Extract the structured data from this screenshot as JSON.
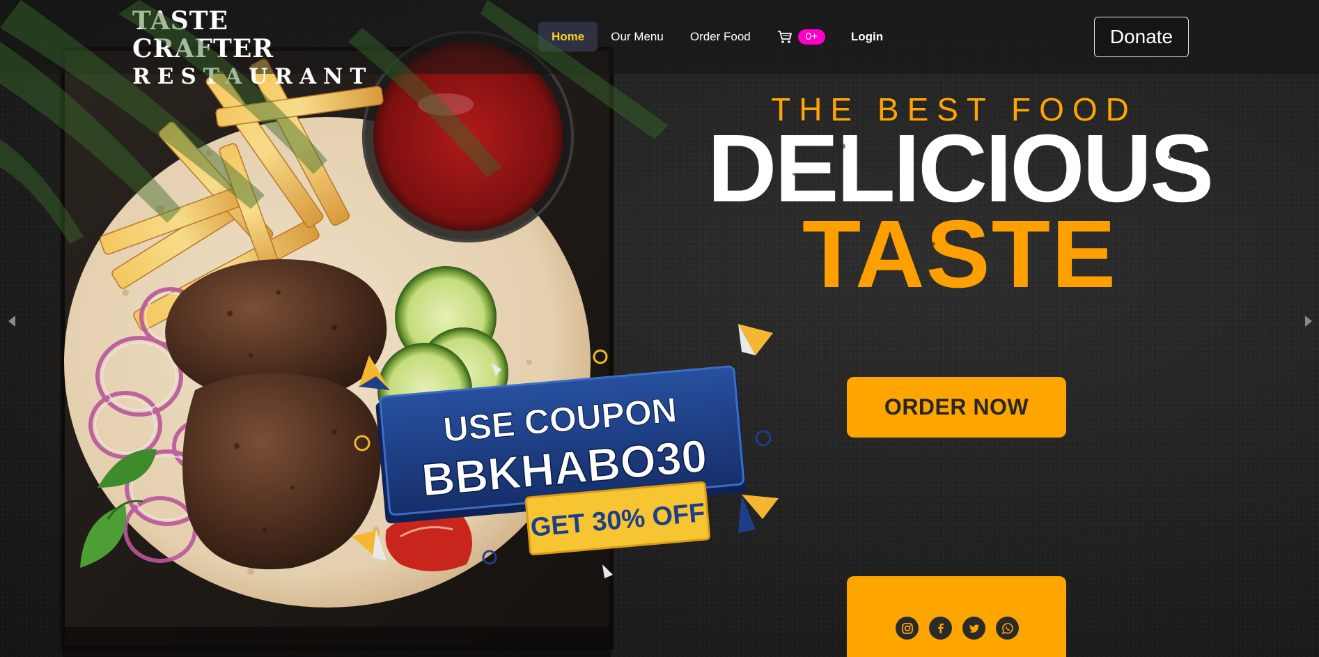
{
  "brand": {
    "name_line1": "TASTE CRAFTER",
    "name_line2": "RESTAURANT"
  },
  "nav": {
    "items": [
      {
        "label": "Home",
        "active": true
      },
      {
        "label": "Our Menu",
        "active": false
      },
      {
        "label": "Order Food",
        "active": false
      }
    ],
    "cart_count": "0+",
    "login_label": "Login",
    "donate_label": "Donate"
  },
  "hero": {
    "kicker": "THE BEST FOOD",
    "title_line1": "DELICIOUS",
    "title_line2": "TASTE",
    "cta_label": "ORDER NOW"
  },
  "promo": {
    "line1": "USE COUPON",
    "code": "BBKHABO30",
    "offer": "GET 30% OFF"
  },
  "social": [
    "instagram-icon",
    "facebook-icon",
    "twitter-icon",
    "whatsapp-icon"
  ],
  "colors": {
    "accent_orange": "#ffa500",
    "active_nav_text": "#ffd21f",
    "cart_badge": "#ff00c8",
    "coupon_blue": "#1d3f8a",
    "coupon_yellow": "#f7c531"
  }
}
